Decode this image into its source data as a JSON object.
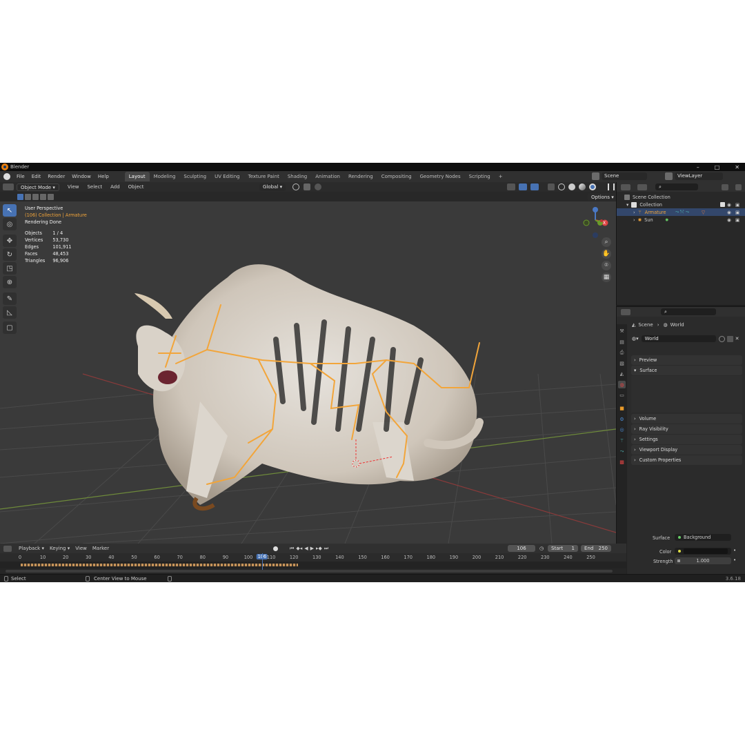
{
  "window": {
    "title": "Blender",
    "min": "–",
    "max": "□",
    "close": "✕"
  },
  "menu": [
    "File",
    "Edit",
    "Render",
    "Window",
    "Help"
  ],
  "workspaces": [
    {
      "label": "Layout",
      "active": true
    },
    {
      "label": "Modeling"
    },
    {
      "label": "Sculpting"
    },
    {
      "label": "UV Editing"
    },
    {
      "label": "Texture Paint"
    },
    {
      "label": "Shading"
    },
    {
      "label": "Animation"
    },
    {
      "label": "Rendering"
    },
    {
      "label": "Compositing"
    },
    {
      "label": "Geometry Nodes"
    },
    {
      "label": "Scripting"
    },
    {
      "label": "+"
    }
  ],
  "scene": {
    "name": "Scene",
    "view_layer": "ViewLayer"
  },
  "viewport_header": {
    "mode": "Object Mode",
    "menus": [
      "View",
      "Select",
      "Add",
      "Object"
    ],
    "orientation": "Global",
    "options": "Options"
  },
  "viewport_info": {
    "view": "User Perspective",
    "collection": "(106) Collection | Armature",
    "status": "Rendering Done",
    "stats": [
      {
        "label": "Objects",
        "value": "1 / 4"
      },
      {
        "label": "Vertices",
        "value": "53,730"
      },
      {
        "label": "Edges",
        "value": "101,911"
      },
      {
        "label": "Faces",
        "value": "48,453"
      },
      {
        "label": "Triangles",
        "value": "96,906"
      }
    ]
  },
  "gizmo": {
    "x": "X",
    "y": "Y",
    "z": "Z"
  },
  "outliner": {
    "root": "Scene Collection",
    "items": [
      {
        "label": "Collection",
        "depth": 1
      },
      {
        "label": "Armature",
        "depth": 2,
        "selected": true
      },
      {
        "label": "Sun",
        "depth": 2
      }
    ]
  },
  "properties": {
    "breadcrumb": [
      "Scene",
      "World"
    ],
    "world_name": "World",
    "panels": [
      "Preview",
      "Surface",
      "Volume",
      "Ray Visibility",
      "Settings",
      "Viewport Display",
      "Custom Properties"
    ],
    "surface": {
      "label": "Surface",
      "value": "Background"
    },
    "color": {
      "label": "Color",
      "value": "#141414"
    },
    "strength": {
      "label": "Strength",
      "value": "1.000"
    }
  },
  "timeline": {
    "menus": [
      "Playback",
      "Keying",
      "View",
      "Marker"
    ],
    "current_frame": "106",
    "start_label": "Start",
    "start": "1",
    "end_label": "End",
    "end": "250",
    "ticks": [
      "0",
      "10",
      "20",
      "30",
      "40",
      "50",
      "60",
      "70",
      "80",
      "90",
      "100",
      "106",
      "110",
      "120",
      "130",
      "140",
      "150",
      "160",
      "170",
      "180",
      "190",
      "200",
      "210",
      "220",
      "230",
      "240",
      "250"
    ]
  },
  "statusbar": {
    "select": "Select",
    "center": "Center View to Mouse",
    "version": "3.6.18"
  }
}
